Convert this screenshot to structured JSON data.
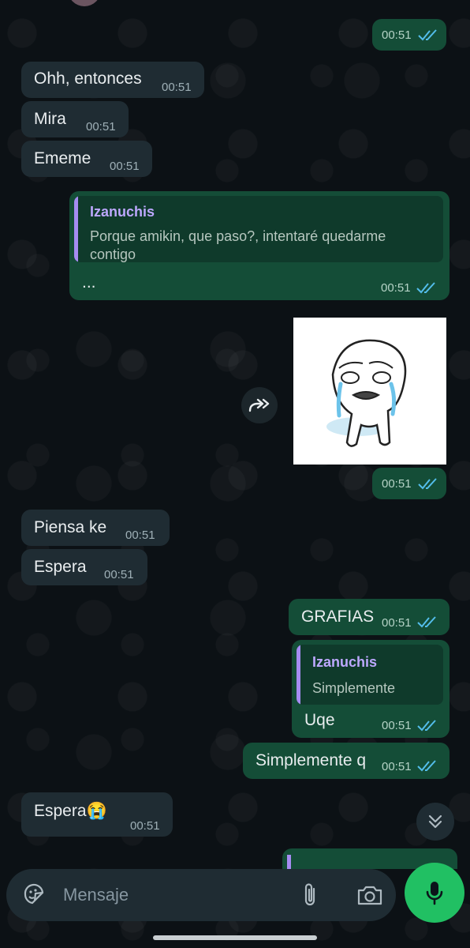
{
  "chat": {
    "messages": [
      {
        "id": "m1",
        "dir": "out",
        "text": "",
        "time": "00:51"
      },
      {
        "id": "m2",
        "dir": "in",
        "text": "Ohh, entonces",
        "time": "00:51"
      },
      {
        "id": "m3",
        "dir": "in",
        "text": "Mira",
        "time": "00:51"
      },
      {
        "id": "m4",
        "dir": "in",
        "text": "Ememe",
        "time": "00:51"
      },
      {
        "id": "m5",
        "dir": "out",
        "quote_author": "Izanuchis",
        "quote_line1": "Porque amikin, que paso?, intentaré quedarme",
        "quote_line2": "contigo",
        "text": "...",
        "time": "00:51"
      },
      {
        "id": "m6",
        "dir": "out",
        "type": "sticker",
        "time": "00:51"
      },
      {
        "id": "m7",
        "dir": "in",
        "text": "Piensa ke",
        "time": "00:51"
      },
      {
        "id": "m8",
        "dir": "in",
        "text": "Espera",
        "time": "00:51"
      },
      {
        "id": "m9",
        "dir": "out",
        "text": "GRAFIAS",
        "time": "00:51"
      },
      {
        "id": "m10",
        "dir": "out",
        "quote_author": "Izanuchis",
        "quote_line1": "Simplemente",
        "text": "Uqe",
        "time": "00:51"
      },
      {
        "id": "m11",
        "dir": "out",
        "text": "Simplemente q",
        "time": "00:51"
      },
      {
        "id": "m12",
        "dir": "in",
        "text": "Espera😭",
        "time": "00:51"
      }
    ]
  },
  "composer": {
    "placeholder": "Mensaje",
    "emoji_icon": "sticker-icon",
    "attach_icon": "paperclip-icon",
    "camera_icon": "camera-icon",
    "mic_icon": "microphone-icon"
  },
  "icons": {
    "forward": "forward-icon",
    "scroll_down": "double-chevron-down-icon",
    "read_receipt": "double-check-icon"
  },
  "colors": {
    "incoming_bubble": "#1f2c33",
    "outgoing_bubble": "#144d37",
    "accent": "#21c063",
    "read_tick": "#53bdeb",
    "quote_bar": "#a68cf2"
  }
}
